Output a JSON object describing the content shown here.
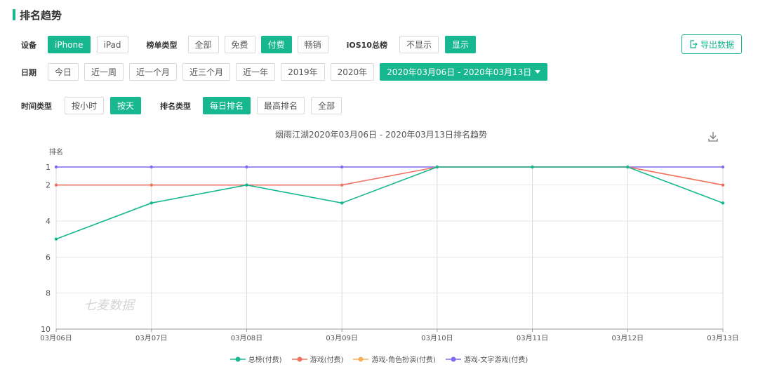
{
  "section_title": "排名趋势",
  "filters": {
    "device": {
      "label": "设备",
      "options": [
        "iPhone",
        "iPad"
      ],
      "active": 0
    },
    "list_type": {
      "label": "榜单类型",
      "options": [
        "全部",
        "免费",
        "付费",
        "畅销"
      ],
      "active": 2
    },
    "ios10": {
      "label": "iOS10总榜",
      "options": [
        "不显示",
        "显示"
      ],
      "active": 1
    },
    "date": {
      "label": "日期",
      "options": [
        "今日",
        "近一周",
        "近一个月",
        "近三个月",
        "近一年",
        "2019年",
        "2020年"
      ],
      "range": "2020年03月06日 - 2020年03月13日"
    },
    "time_type": {
      "label": "时间类型",
      "options": [
        "按小时",
        "按天"
      ],
      "active": 1
    },
    "rank_type": {
      "label": "排名类型",
      "options": [
        "每日排名",
        "最高排名",
        "全部"
      ],
      "active": 0
    }
  },
  "export_label": "导出数据",
  "watermark": "七麦数据",
  "accent_color": "#17b890",
  "chart_data": {
    "type": "line",
    "title": "烟雨江湖2020年03月06日 - 2020年03月13日排名趋势",
    "ylabel": "排名",
    "xlabel": "",
    "y_inverted": true,
    "ylim": [
      1,
      10
    ],
    "yticks": [
      1,
      2,
      4,
      6,
      8,
      10
    ],
    "categories": [
      "03月06日",
      "03月07日",
      "03月08日",
      "03月09日",
      "03月10日",
      "03月11日",
      "03月12日",
      "03月13日"
    ],
    "series": [
      {
        "name": "总榜(付费)",
        "color": "#17b890",
        "values": [
          5,
          3,
          2,
          3,
          1,
          1,
          1,
          3
        ]
      },
      {
        "name": "游戏(付费)",
        "color": "#f07264",
        "values": [
          2,
          2,
          2,
          2,
          1,
          1,
          1,
          2
        ]
      },
      {
        "name": "游戏-角色扮演(付费)",
        "color": "#f7b05b",
        "values": [
          null,
          null,
          null,
          null,
          null,
          null,
          1,
          2
        ]
      },
      {
        "name": "游戏-文字游戏(付费)",
        "color": "#7b6cf0",
        "values": [
          1,
          1,
          1,
          1,
          1,
          1,
          1,
          1
        ]
      }
    ],
    "grid": true,
    "legend_position": "bottom"
  }
}
